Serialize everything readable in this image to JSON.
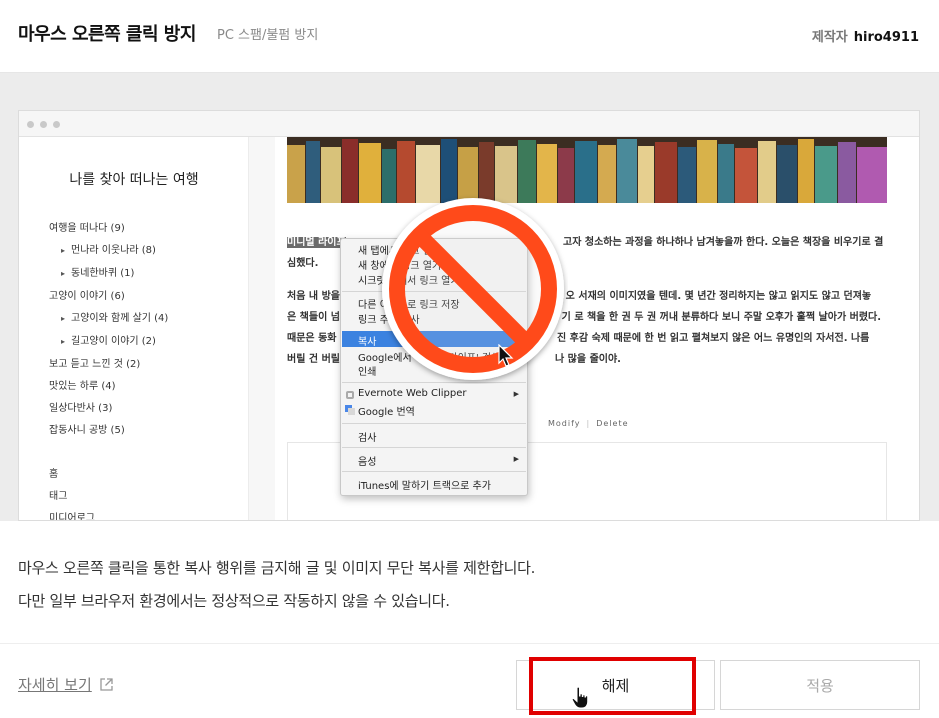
{
  "header": {
    "title": "마우스 오른쪽 클릭 방지",
    "subtitle": "PC 스팸/불펌 방지",
    "author_label": "제작자",
    "author_name": "hiro4911"
  },
  "preview": {
    "blog_title": "나를 찾아 떠나는 여행",
    "categories": [
      {
        "label": "여행을 떠나다 (9)",
        "sub": false
      },
      {
        "label": "먼나라 이웃나라 (8)",
        "sub": true
      },
      {
        "label": "동네한바퀴 (1)",
        "sub": true
      },
      {
        "label": "고양이 이야기 (6)",
        "sub": false
      },
      {
        "label": "고양이와 함께 살기 (4)",
        "sub": true
      },
      {
        "label": "길고양이 이야기 (2)",
        "sub": true
      },
      {
        "label": "보고 듣고 느낀 것 (2)",
        "sub": false
      },
      {
        "label": "맛있는 하루 (4)",
        "sub": false
      },
      {
        "label": "일상다반사 (3)",
        "sub": false
      },
      {
        "label": "잡동사니 공방 (5)",
        "sub": false
      }
    ],
    "nav": [
      "홈",
      "태그",
      "미디어로그"
    ],
    "article": {
      "highlight": "미니멀 라이프",
      "line1_rest": "고자 청소하는 과정을 하나하나 남겨놓을까 한다. 오늘은 책장을 비우기로 결",
      "line2": "심했다.",
      "line3": "처음 내 방을",
      "line3_rest": "인 오 서재의 이미지였을 텐데. 몇 년간 정리하지는 않고 읽지도 않고 던져놓",
      "line4": "은 책들이 넘",
      "line4_rest": "는 기 로 책을 한 권 두 권 꺼내 분류하다 보니 주말 오후가 훌쩍 날아가 버렸다.",
      "line5": "때문은 동화",
      "line5_rest": "진 후감 숙제 때문에 한 번 읽고 펼쳐보지 않은 어느 유명인의 자서전. 나름",
      "line6": "버릴 건 버릴",
      "line6_rest": "나 많을 줄이야."
    },
    "meta_modify": "Modify",
    "meta_delete": "Delete",
    "context_menu": {
      "items": [
        "새 탭에서 링크 열기",
        "새 창에서 링크 열기",
        "시크릿 창에서 링크 열기",
        "다른 이름으로 링크 저장",
        "링크 주소 복사",
        "복사",
        "Google에서 '미니멀 라이프' 검색",
        "인쇄",
        "Evernote Web Clipper",
        "Google 번역",
        "검사",
        "음성",
        "iTunes에 말하기 트랙으로 추가"
      ]
    }
  },
  "panel": {
    "desc_line1": "마우스 오른쪽 클릭을 통한 복사 행위를 금지해 글 및 이미지 무단 복사를 제한합니다.",
    "desc_line2": "다만 일부 브라우저 환경에서는 정상적으로 작동하지 않을 수 있습니다.",
    "detail_link": "자세히 보기",
    "release_button": "해제",
    "apply_button": "적용"
  },
  "colors": {
    "highlight_frame": "#e00000",
    "ban_sign": "#ff4a1a",
    "menu_selection": "#3b82e0"
  }
}
